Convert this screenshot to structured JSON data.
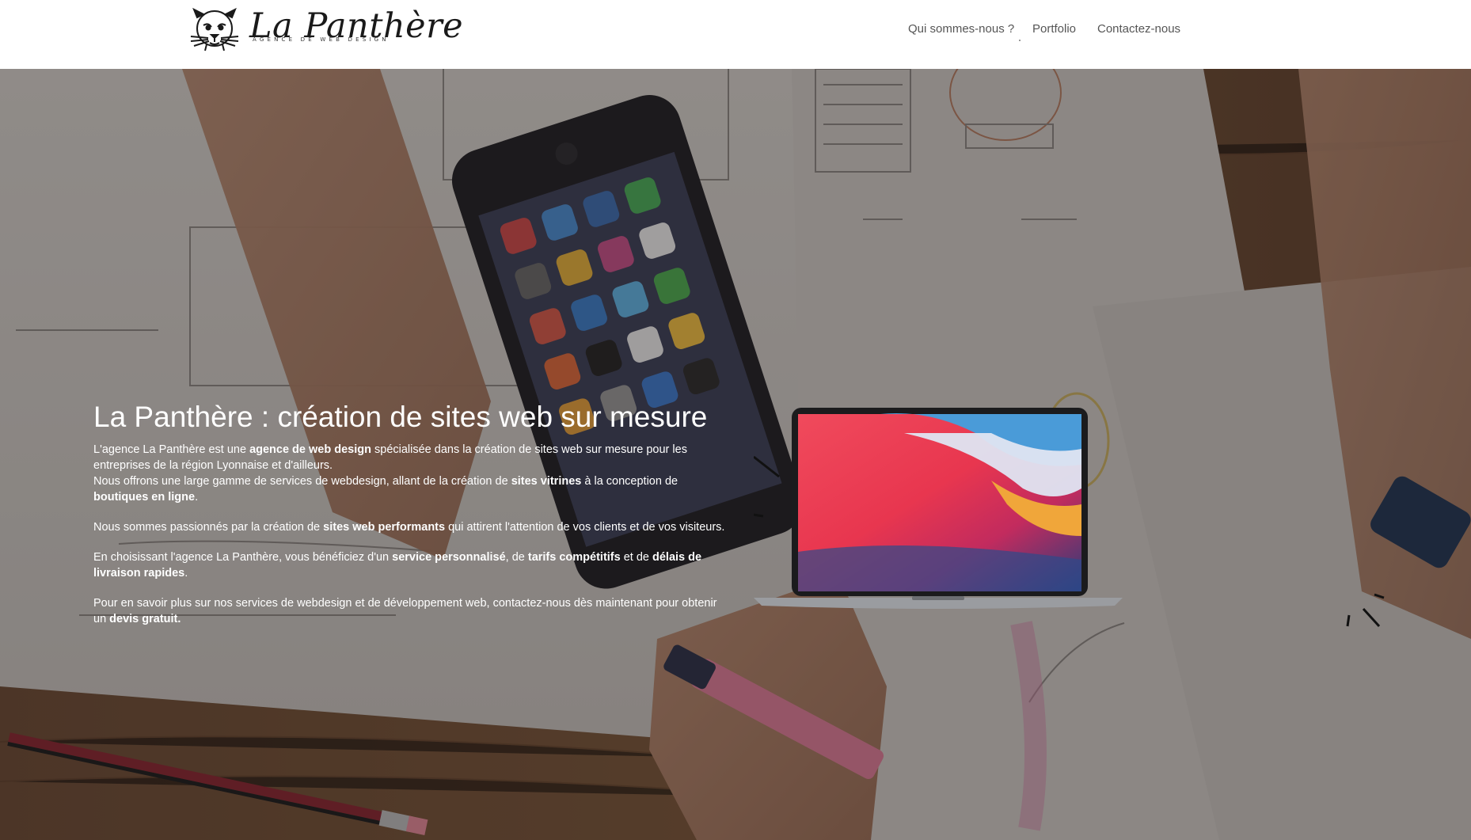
{
  "header": {
    "logo_title": "La Panthère",
    "logo_tagline": "AGENCE DE WEB DESIGN",
    "logo_icon": "panther-head-icon",
    "nav": [
      {
        "label": "Qui sommes-nous ?"
      },
      {
        "label": "Portfolio"
      },
      {
        "label": "Contactez-nous"
      }
    ]
  },
  "hero": {
    "title": "La Panthère : création de sites web sur mesure",
    "p1": {
      "a": "L'agence La Panthère est une ",
      "b1": "agence de web design",
      "c": " spécialisée dans la création de sites web sur mesure pour les entreprises de la région Lyonnaise et d'ailleurs.",
      "d": "Nous offrons une large gamme de services de webdesign, allant de la création de ",
      "b2": "sites vitrines",
      "e": " à la conception de ",
      "b3": "boutiques en ligne",
      "f": "."
    },
    "p2": {
      "a": "Nous sommes passionnés par la création de ",
      "b1": "sites web performants",
      "c": " qui attirent l'attention de vos clients et de vos visiteurs."
    },
    "p3": {
      "a": "En choisissant l'agence La Panthère, vous bénéficiez d'un ",
      "b1": "service personnalisé",
      "c": ", de ",
      "b2": "tarifs compétitifs",
      "d": " et de ",
      "b3": "délais de livraison rapides",
      "e": "."
    },
    "p4": {
      "a": "Pour en savoir plus sur nos services de webdesign et de développement web, contactez-nous dès maintenant pour obtenir un ",
      "b1": "devis gratuit."
    },
    "laptop_image": "laptop-icon",
    "background_image": "desk-sketch-photo"
  }
}
